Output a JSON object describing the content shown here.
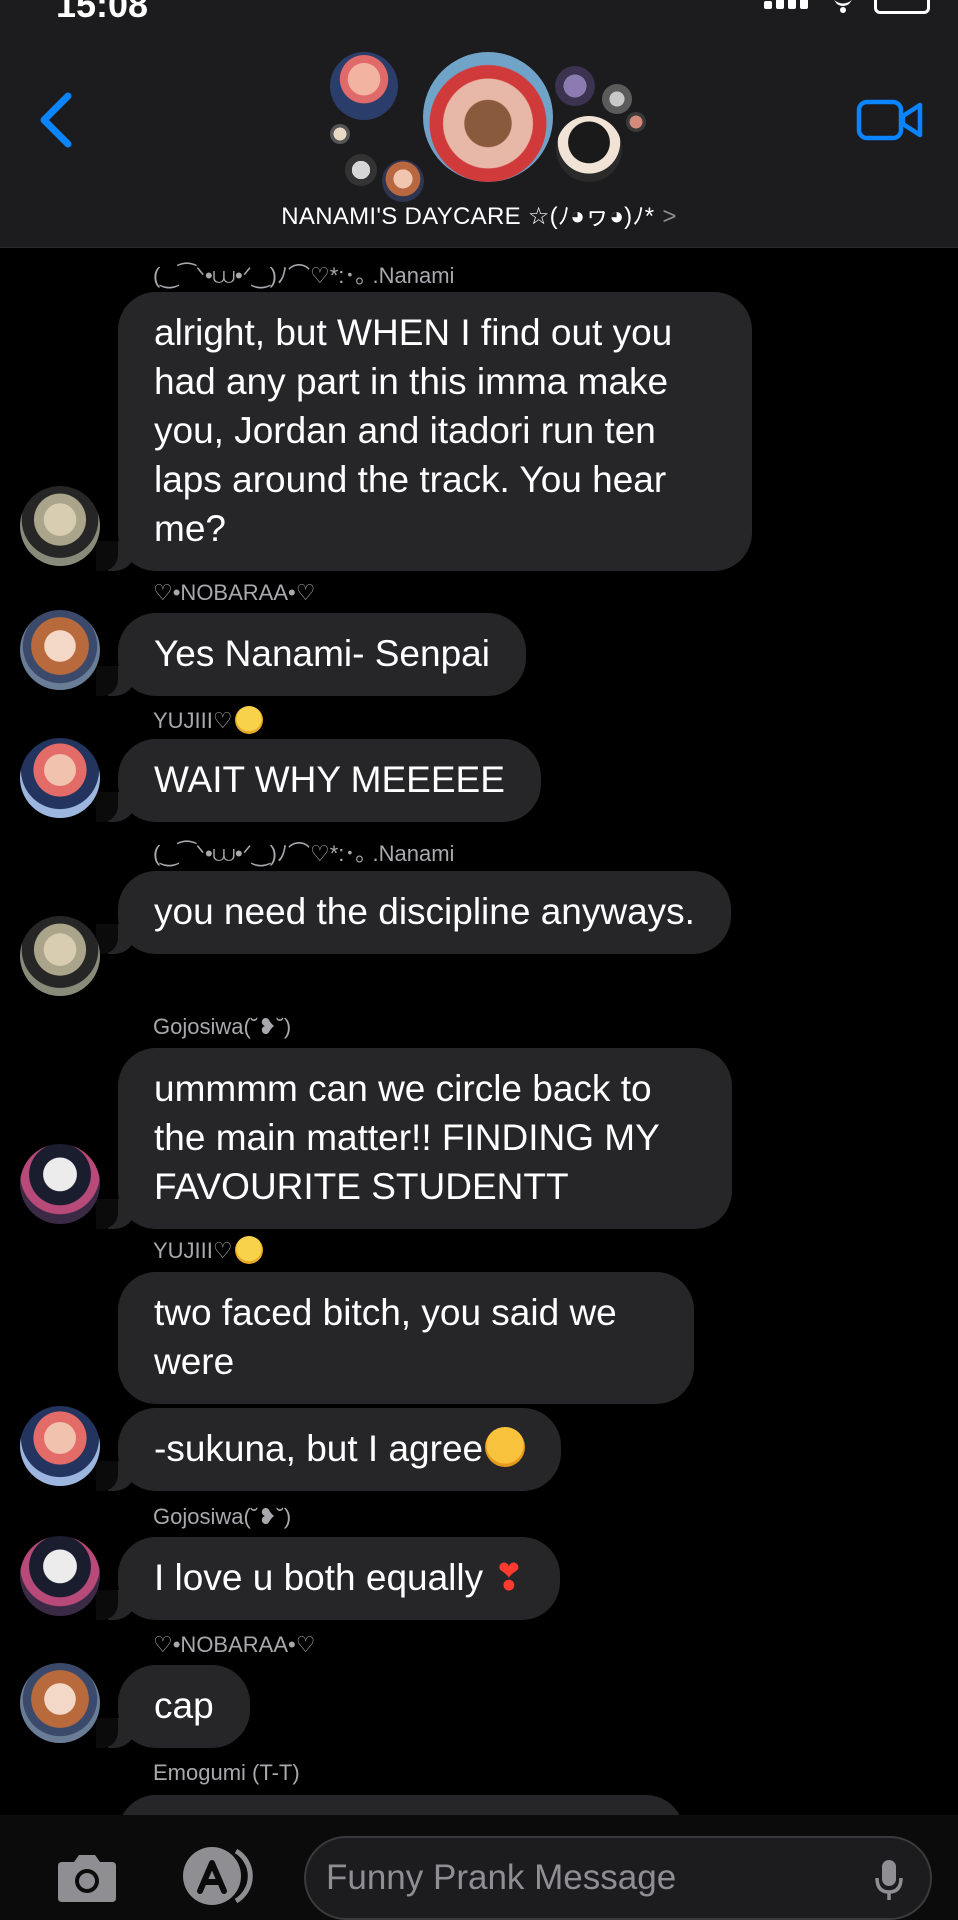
{
  "status_bar": {
    "time": "15:08"
  },
  "header": {
    "back_icon": "chevron-left-icon",
    "video_icon": "video-camera-icon",
    "group_name": "NANAMI'S DAYCARE ☆(ﾉ◕ヮ◕)ﾉ*",
    "chevron": ">",
    "accent_color": "#0a84ff"
  },
  "messages": [
    {
      "sender": "(‿⁀ᐠ•⩊•ᐟ‿)ﾉ⌒♡*:･｡ .Nanami",
      "text": "alright, but WHEN I find out you had any part in this imma make you, Jordan and itadori run ten laps around the track. You hear me?"
    },
    {
      "sender": "♡•NOBARAA•♡",
      "text": "Yes Nanami- Senpai"
    },
    {
      "sender": "YUJIII♡",
      "sender_emoji": "pleading-face-emoji",
      "text": "WAIT WHY MEEEEE"
    },
    {
      "sender": "(‿⁀ᐠ•⩊•ᐟ‿)ﾉ⌒♡*:･｡ .Nanami",
      "text": "you need the discipline anyways."
    },
    {
      "sender": "Gojosiwa(˘❥˘)",
      "text": "ummmm can we circle back to the main matter!! FINDING MY FAVOURITE STUDENTT"
    },
    {
      "sender": "YUJIII♡",
      "sender_emoji": "pleading-face-emoji",
      "text": "two faced bitch, you said we were"
    },
    {
      "text": "-sukuna, but I agree",
      "emoji": "angry-face-emoji"
    },
    {
      "sender": "Gojosiwa(˘❥˘)",
      "text": "I love u both equally",
      "trailing": "❣"
    },
    {
      "sender": "♡•NOBARAA•♡",
      "text": "cap"
    },
    {
      "sender": "Emogumi (T-T)"
    }
  ],
  "input_bar": {
    "camera_icon": "camera-icon",
    "appstore_icon": "app-store-icon",
    "placeholder": "Funny Prank Message",
    "mic_icon": "microphone-icon"
  }
}
